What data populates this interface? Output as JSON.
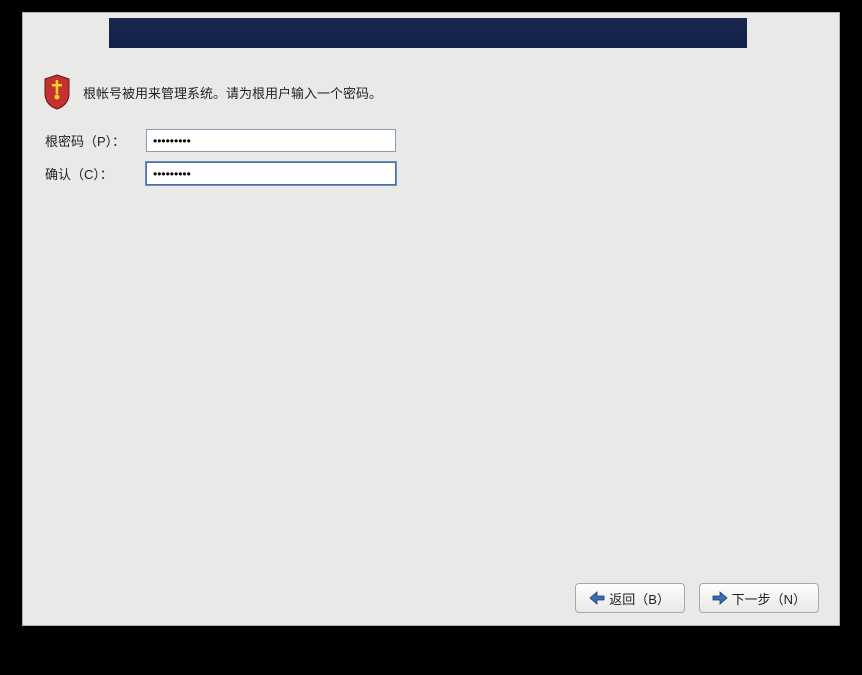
{
  "intro": {
    "text": "根帐号被用来管理系统。请为根用户输入一个密码。"
  },
  "form": {
    "password_label": "根密码（P）：",
    "password_value": "•••••••••",
    "confirm_label": "确认（C）：",
    "confirm_value": "•••••••••"
  },
  "footer": {
    "back_label": "返回（B）",
    "next_label": "下一步（N）"
  }
}
